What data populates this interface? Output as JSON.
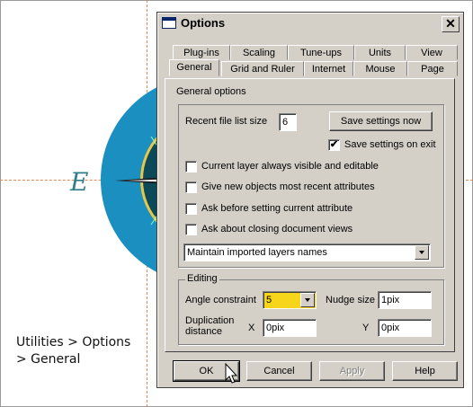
{
  "caption": {
    "line1": "Utilities > Options",
    "line2": "> General"
  },
  "compass_letter": "E",
  "dialog": {
    "title": "Options",
    "close_label": "✕",
    "tabs_back": [
      "Plug-ins",
      "Scaling",
      "Tune-ups",
      "Units",
      "View"
    ],
    "tabs_front": [
      "General",
      "Grid and Ruler",
      "Internet",
      "Mouse",
      "Page"
    ],
    "active_tab": "General",
    "general": {
      "section_label": "General options",
      "recent_files_label": "Recent file list size",
      "recent_files_value": "6",
      "save_settings_now": "Save settings now",
      "save_on_exit_label": "Save settings on exit",
      "save_on_exit_checked": true,
      "checkboxes": [
        {
          "label": "Current layer always visible and editable",
          "checked": false
        },
        {
          "label": "Give new objects most recent attributes",
          "checked": false
        },
        {
          "label": "Ask before setting current attribute",
          "checked": false
        },
        {
          "label": "Ask about closing document views",
          "checked": false
        }
      ],
      "layers_dropdown": "Maintain imported layers names"
    },
    "editing": {
      "title": "Editing",
      "angle_label": "Angle constraint",
      "angle_value": "5",
      "nudge_label": "Nudge size",
      "nudge_value": "1pix",
      "dup_label_line1": "Duplication",
      "dup_label_line2": "distance",
      "x_label": "X",
      "x_value": "0pix",
      "y_label": "Y",
      "y_value": "0pix"
    },
    "buttons": {
      "ok": "OK",
      "cancel": "Cancel",
      "apply": "Apply",
      "help": "Help"
    }
  },
  "colors": {
    "dialog_bg": "#d4d0c8",
    "angle_highlight": "#f7d51b",
    "compass_blue": "#1a8fc0",
    "compass_dark": "#0c4a5a"
  }
}
